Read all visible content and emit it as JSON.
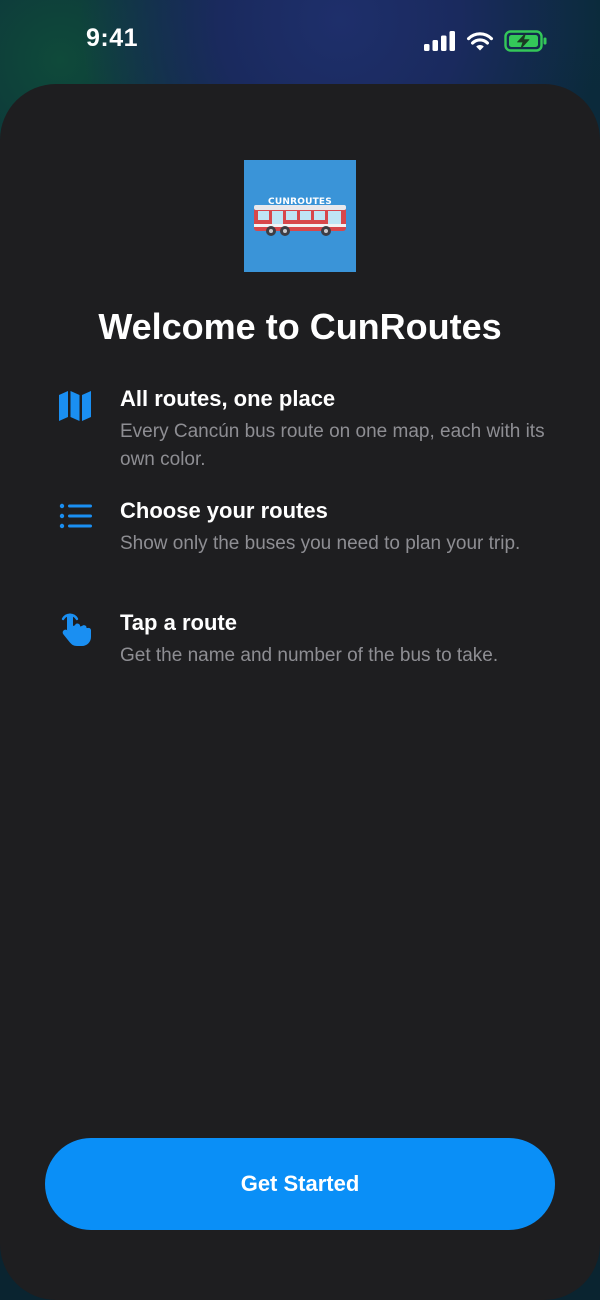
{
  "status_bar": {
    "time": "9:41"
  },
  "icons": {
    "signal": "cellular-signal-icon",
    "wifi": "wifi-icon",
    "battery": "battery-charging-icon"
  },
  "app": {
    "icon_label": "CUNROUTES",
    "title": "Welcome to CunRoutes"
  },
  "features": [
    {
      "icon": "map-icon",
      "title": "All routes, one place",
      "description": "Every Cancún bus route on one map, each with its own color."
    },
    {
      "icon": "list-icon",
      "title": "Choose your routes",
      "description": "Show only the buses you need to plan your trip."
    },
    {
      "icon": "tap-hand-icon",
      "title": "Tap a route",
      "description": "Get the name and number of the bus to take."
    }
  ],
  "cta": {
    "label": "Get Started"
  },
  "colors": {
    "accent": "#0A8FF7",
    "sheet_background": "#1E1E20",
    "secondary_text": "#8E8E93",
    "battery_green": "#34C759"
  }
}
